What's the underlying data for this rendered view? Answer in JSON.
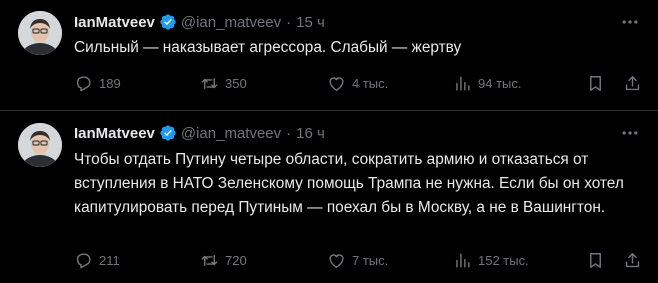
{
  "colors": {
    "background": "#000000",
    "text": "#e7e9ea",
    "muted": "#71767b",
    "verified": "#1d9bf0",
    "divider": "#2f3336"
  },
  "tweets": [
    {
      "name": "IanMatveev",
      "handle": "@ian_matveev",
      "separator": "·",
      "time": "15 ч",
      "text": "Сильный — наказывает агрессора. Слабый — жертву",
      "replies": "189",
      "retweets": "350",
      "likes": "4 тыс.",
      "views": "94 тыс.",
      "icons": [
        "more-icon",
        "reply-icon",
        "retweet-icon",
        "like-icon",
        "views-icon",
        "bookmark-icon",
        "share-icon"
      ]
    },
    {
      "name": "IanMatveev",
      "handle": "@ian_matveev",
      "separator": "·",
      "time": "16 ч",
      "text": "Чтобы отдать Путину четыре области, сократить армию и отказаться от вступления в НАТО Зеленскому помощь Трампа не нужна. Если бы он хотел капитулировать перед Путиным — поехал бы в Москву, а не в Вашингтон.",
      "replies": "211",
      "retweets": "720",
      "likes": "7 тыс.",
      "views": "152 тыс.",
      "icons": [
        "more-icon",
        "reply-icon",
        "retweet-icon",
        "like-icon",
        "views-icon",
        "bookmark-icon",
        "share-icon"
      ]
    }
  ]
}
